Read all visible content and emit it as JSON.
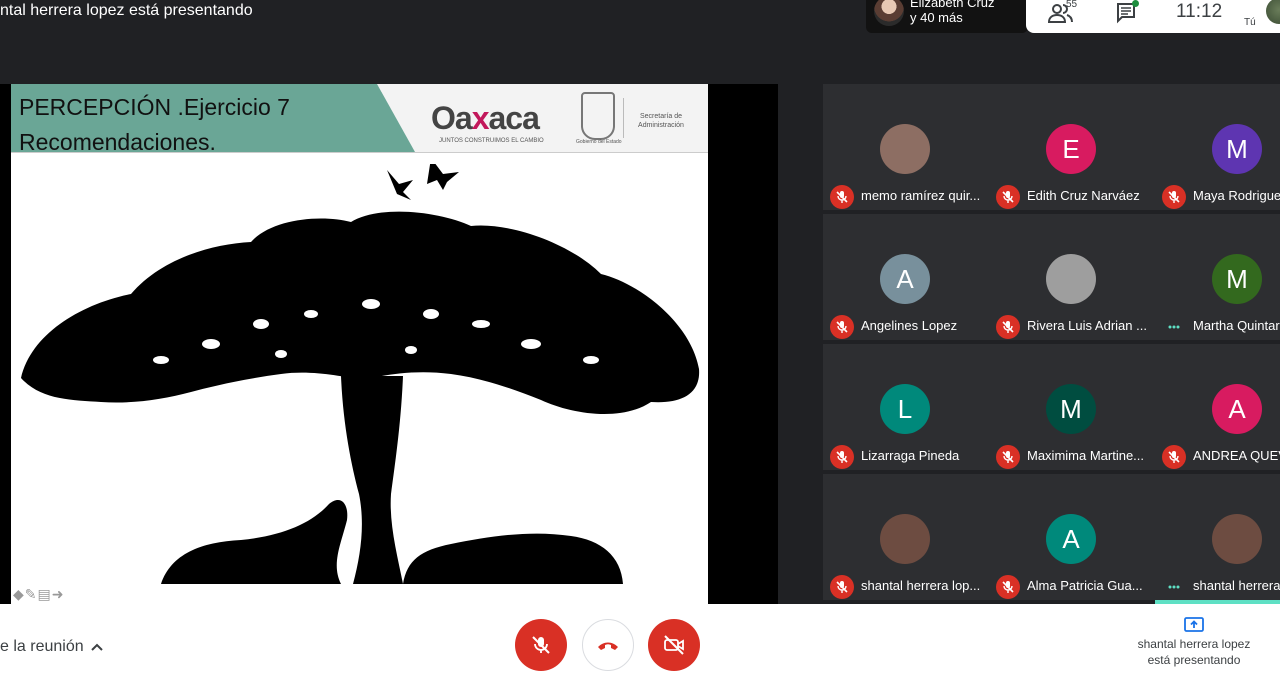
{
  "top": {
    "presenting_banner": "ntal herrera lopez está presentando",
    "notification": {
      "line1": "Elizabeth Cruz",
      "line2": "y 40 más"
    },
    "participants_count": "55",
    "time": "11:12",
    "self_label": "Tú"
  },
  "slide": {
    "title_line1": "PERCEPCIÓN .Ejercicio 7",
    "title_line2": "Recomendaciones.",
    "logo_text_a": "Oa",
    "logo_text_x": "x",
    "logo_text_b": "aca",
    "logo_tagline": "JUNTOS CONSTRUIMOS EL CAMBIO",
    "shield_caption": "Gobierno del Estado",
    "secretaria": "Secretaría de Administración",
    "nav_glyphs": "◆✎▤➜"
  },
  "participants": [
    {
      "name": "memo ramírez quir...",
      "initial": "",
      "color": "#8d6e63",
      "muted": true
    },
    {
      "name": "Edith Cruz Narváez",
      "initial": "E",
      "color": "#d81b60",
      "muted": true
    },
    {
      "name": "Maya Rodrigue",
      "initial": "M",
      "color": "#5e35b1",
      "muted": true
    },
    {
      "name": "Angelines Lopez",
      "initial": "A",
      "color": "#78909c",
      "muted": true
    },
    {
      "name": "Rivera Luis Adrian ...",
      "initial": "",
      "color": "#9e9e9e",
      "muted": true
    },
    {
      "name": "Martha Quintar",
      "initial": "M",
      "color": "#33691e",
      "muted": false
    },
    {
      "name": "Lizarraga Pineda",
      "initial": "L",
      "color": "#00897b",
      "muted": true
    },
    {
      "name": "Maximima Martine...",
      "initial": "M",
      "color": "#004d40",
      "muted": true
    },
    {
      "name": "ANDREA QUEV",
      "initial": "A",
      "color": "#d81b60",
      "muted": true
    },
    {
      "name": "shantal herrera lop...",
      "initial": "",
      "color": "#6d4c41",
      "muted": true
    },
    {
      "name": "Alma Patricia Gua...",
      "initial": "A",
      "color": "#00897b",
      "muted": true
    },
    {
      "name": "shantal herrera",
      "initial": "",
      "color": "#6d4c41",
      "muted": false
    }
  ],
  "bottom": {
    "meeting_details": "e la reunión",
    "presenting_line1": "shantal herrera lopez",
    "presenting_line2": "está presentando"
  }
}
